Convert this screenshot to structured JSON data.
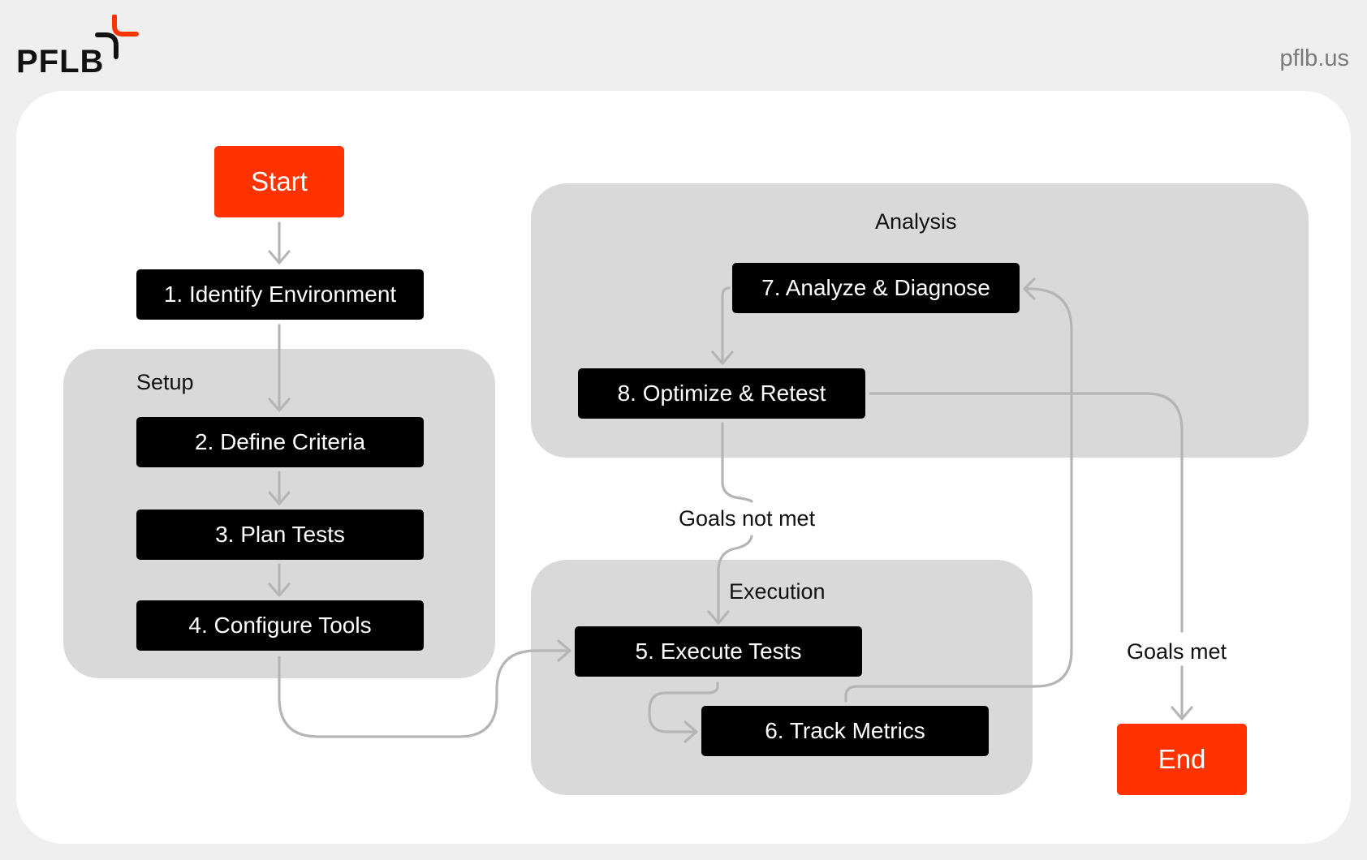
{
  "header": {
    "logo_text": "PFLB",
    "site": "pflb.us",
    "brand_color": "#ff3300"
  },
  "groups": {
    "setup": "Setup",
    "analysis": "Analysis",
    "execution": "Execution"
  },
  "terminals": {
    "start": "Start",
    "end": "End"
  },
  "steps": [
    {
      "id": "identify",
      "label": "1. Identify Environment"
    },
    {
      "id": "define",
      "label": "2. Define Criteria"
    },
    {
      "id": "plan",
      "label": "3. Plan Tests"
    },
    {
      "id": "configure",
      "label": "4. Configure Tools"
    },
    {
      "id": "execute",
      "label": "5. Execute Tests"
    },
    {
      "id": "track",
      "label": "6. Track Metrics"
    },
    {
      "id": "analyze",
      "label": "7. Analyze & Diagnose"
    },
    {
      "id": "optimize",
      "label": "8. Optimize & Retest"
    }
  ],
  "edge_labels": {
    "not_met": "Goals not met",
    "met": "Goals met"
  },
  "edges": [
    {
      "from": "Start",
      "to": "1. Identify Environment"
    },
    {
      "from": "1. Identify Environment",
      "to": "2. Define Criteria"
    },
    {
      "from": "2. Define Criteria",
      "to": "3. Plan Tests"
    },
    {
      "from": "3. Plan Tests",
      "to": "4. Configure Tools"
    },
    {
      "from": "4. Configure Tools",
      "to": "5. Execute Tests"
    },
    {
      "from": "5. Execute Tests",
      "to": "6. Track Metrics"
    },
    {
      "from": "6. Track Metrics",
      "to": "7. Analyze & Diagnose"
    },
    {
      "from": "7. Analyze & Diagnose",
      "to": "8. Optimize & Retest"
    },
    {
      "from": "8. Optimize & Retest",
      "to": "5. Execute Tests",
      "label": "Goals not met"
    },
    {
      "from": "8. Optimize & Retest",
      "to": "End",
      "label": "Goals met"
    }
  ]
}
